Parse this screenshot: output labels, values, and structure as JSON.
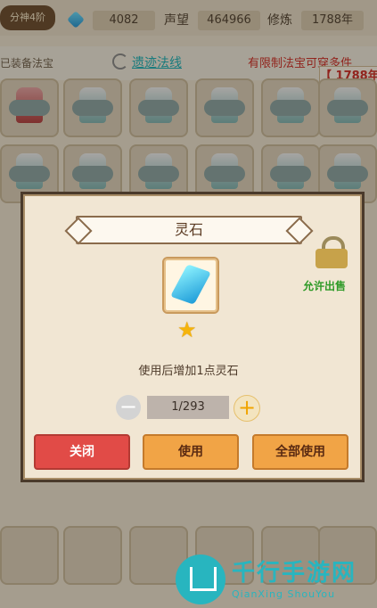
{
  "topbar": {
    "tag": "分神4阶",
    "resource_value": "4082",
    "fame_label": "声望",
    "fame_value": "464966",
    "cultivate_label": "修炼",
    "cultivate_value": "1788年"
  },
  "header": {
    "left_text": "已装备法宝",
    "link_text": "遗迹法线",
    "red_text": "有限制法宝可穿多件",
    "box_text": "【 1788年"
  },
  "dialog": {
    "title": "灵石",
    "allow_sell": "允许出售",
    "description": "使用后增加1点灵石",
    "quantity": "1/293",
    "close_button": "关闭",
    "use_button": "使用",
    "use_all_button": "全部使用"
  },
  "watermark": {
    "title": "千行手游网",
    "subtitle": "QianXing ShouYou"
  },
  "colors": {
    "red_button": "#e14b47",
    "orange_button": "#f1a446",
    "teal": "#28b5bf"
  }
}
